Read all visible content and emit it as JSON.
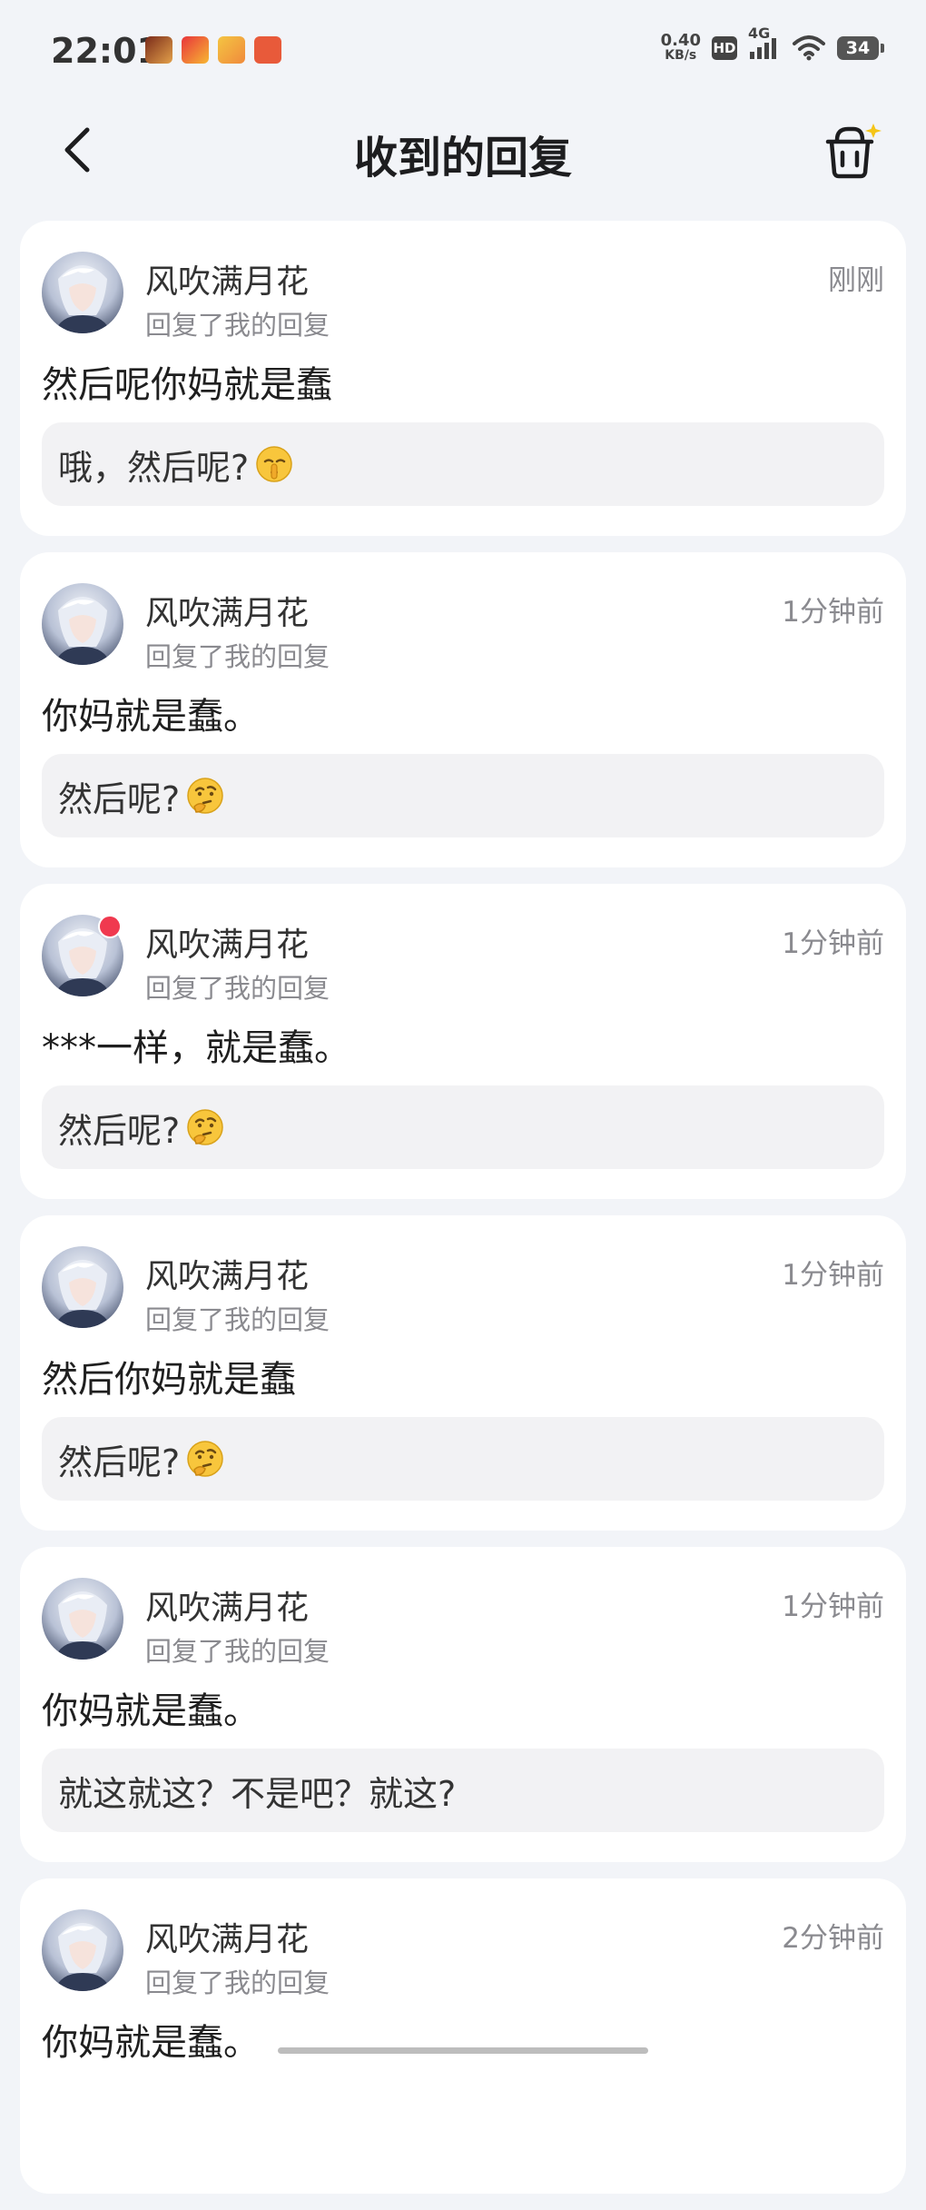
{
  "status_bar": {
    "time": "22:01",
    "net_speed_value": "0.40",
    "net_speed_unit": "KB/s",
    "hd": "HD",
    "network": "4G",
    "battery": "34"
  },
  "header": {
    "title": "收到的回复"
  },
  "replies": [
    {
      "name": "风吹满月花",
      "action": "回复了我的回复",
      "time": "刚刚",
      "content": "然后呢你妈就是蠢",
      "quote": "哦，然后呢?",
      "quote_emoji": "shush-face-icon",
      "unread": false
    },
    {
      "name": "风吹满月花",
      "action": "回复了我的回复",
      "time": "1分钟前",
      "content": "你妈就是蠢。",
      "quote": "然后呢?",
      "quote_emoji": "thinking-face-icon",
      "unread": false
    },
    {
      "name": "风吹满月花",
      "action": "回复了我的回复",
      "time": "1分钟前",
      "content": "***一样，就是蠢。",
      "quote": "然后呢?",
      "quote_emoji": "thinking-face-icon",
      "unread": true
    },
    {
      "name": "风吹满月花",
      "action": "回复了我的回复",
      "time": "1分钟前",
      "content": "然后你妈就是蠢",
      "quote": "然后呢?",
      "quote_emoji": "thinking-face-icon",
      "unread": false
    },
    {
      "name": "风吹满月花",
      "action": "回复了我的回复",
      "time": "1分钟前",
      "content": "你妈就是蠢。",
      "quote": "就这就这？不是吧？就这?",
      "quote_emoji": "",
      "unread": false
    },
    {
      "name": "风吹满月花",
      "action": "回复了我的回复",
      "time": "2分钟前",
      "content": "你妈就是蠢。",
      "quote": "",
      "quote_emoji": "",
      "unread": false
    }
  ],
  "colors": {
    "background": "#f2f4f8",
    "card": "#ffffff",
    "quote_bg": "#f2f2f4",
    "secondary_text": "#8a8a8f",
    "unread_dot": "#f0394f"
  }
}
